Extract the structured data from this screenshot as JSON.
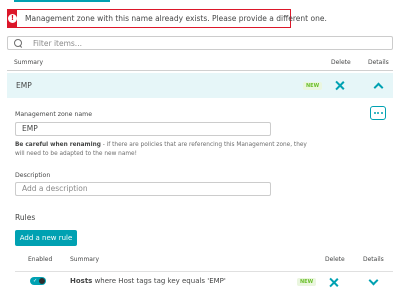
{
  "error": {
    "message": "Management zone with this name already exists. Please provide a different one."
  },
  "filter": {
    "placeholder": "Filter items..."
  },
  "table": {
    "summary_header": "Summary",
    "delete_header": "Delete",
    "details_header": "Details"
  },
  "zone_row": {
    "name": "EMP",
    "badge": "NEW"
  },
  "form": {
    "name_label": "Management zone name",
    "name_value": "EMP",
    "warning_bold": "Be careful when renaming",
    "warning_rest": " - if there are policies that are referencing this Management zone, they will need to be adapted to the new name!",
    "description_label": "Description",
    "description_placeholder": "Add a description"
  },
  "rules": {
    "title": "Rules",
    "add_button": "Add a new rule",
    "enabled_header": "Enabled",
    "summary_header": "Summary",
    "delete_header": "Delete",
    "details_header": "Details",
    "items": [
      {
        "entity": "Hosts",
        "condition": " where Host tags tag key equals 'EMP'",
        "badge": "NEW",
        "enabled": true
      }
    ]
  },
  "colors": {
    "accent": "#00a1b2",
    "error": "#dc172a",
    "row_highlight": "#e6f6f8",
    "badge_green": "#6bbf2a"
  }
}
